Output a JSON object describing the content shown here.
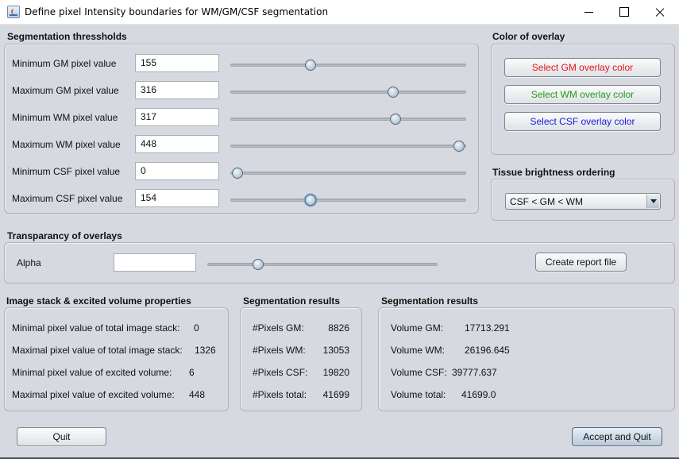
{
  "window": {
    "title": "Define pixel Intensity boundaries for WM/GM/CSF segmentation",
    "icon": "java-app-icon",
    "controls": [
      "minimize-icon",
      "maximize-icon",
      "close-icon"
    ]
  },
  "thresholds": {
    "title": "Segmentation thressholds",
    "rows": [
      {
        "label": "Minimum GM pixel value",
        "value": "155",
        "slider_fraction": 0.34
      },
      {
        "label": "Maximum GM pixel value",
        "value": "316",
        "slider_fraction": 0.69
      },
      {
        "label": "Minimum WM pixel value",
        "value": "317",
        "slider_fraction": 0.7
      },
      {
        "label": "Maximum WM pixel value",
        "value": "448",
        "slider_fraction": 0.97
      },
      {
        "label": "Minimum CSF pixel value",
        "value": "0",
        "slider_fraction": 0.03
      },
      {
        "label": "Maximum CSF pixel value",
        "value": "154",
        "slider_fraction": 0.34
      }
    ]
  },
  "overlay_colors": {
    "title": "Color of overlay",
    "buttons": [
      {
        "label": "Select GM overlay color",
        "color": "#e8151b"
      },
      {
        "label": "Select WM overlay color",
        "color": "#1f9a1f"
      },
      {
        "label": "Select CSF overlay color",
        "color": "#1a1ae0"
      }
    ]
  },
  "brightness": {
    "title": "Tissue brightness ordering",
    "selected": "CSF < GM < WM"
  },
  "transparency": {
    "title": "Transparancy of overlays",
    "alpha_label": "Alpha",
    "alpha_value": "",
    "slider_fraction": 0.22,
    "report_button": "Create report file"
  },
  "stack_props": {
    "title": "Image stack & excited volume properties",
    "rows": [
      {
        "label": "Minimal pixel value of total image stack:",
        "value": "0"
      },
      {
        "label": "Maximal pixel value of total image stack:",
        "value": "1326"
      },
      {
        "label": "Minimal pixel value of excited volume:",
        "value": "6"
      },
      {
        "label": "Maximal pixel value of excited volume:",
        "value": "448"
      }
    ]
  },
  "pixel_results": {
    "title": "Segmentation results",
    "rows": [
      {
        "label": "#Pixels GM:",
        "value": "8826"
      },
      {
        "label": "#Pixels WM:",
        "value": "13053"
      },
      {
        "label": "#Pixels CSF:",
        "value": "19820"
      },
      {
        "label": "#Pixels total:",
        "value": "41699"
      }
    ]
  },
  "volume_results": {
    "title": "Segmentation results",
    "rows": [
      {
        "label": "Volume GM:",
        "value": "17713.291"
      },
      {
        "label": "Volume WM:",
        "value": "26196.645"
      },
      {
        "label": "Volume CSF:",
        "value": "39777.637"
      },
      {
        "label": "Volume total:",
        "value": "41699.0"
      }
    ]
  },
  "footer": {
    "quit": "Quit",
    "accept_quit": "Accept and Quit"
  }
}
